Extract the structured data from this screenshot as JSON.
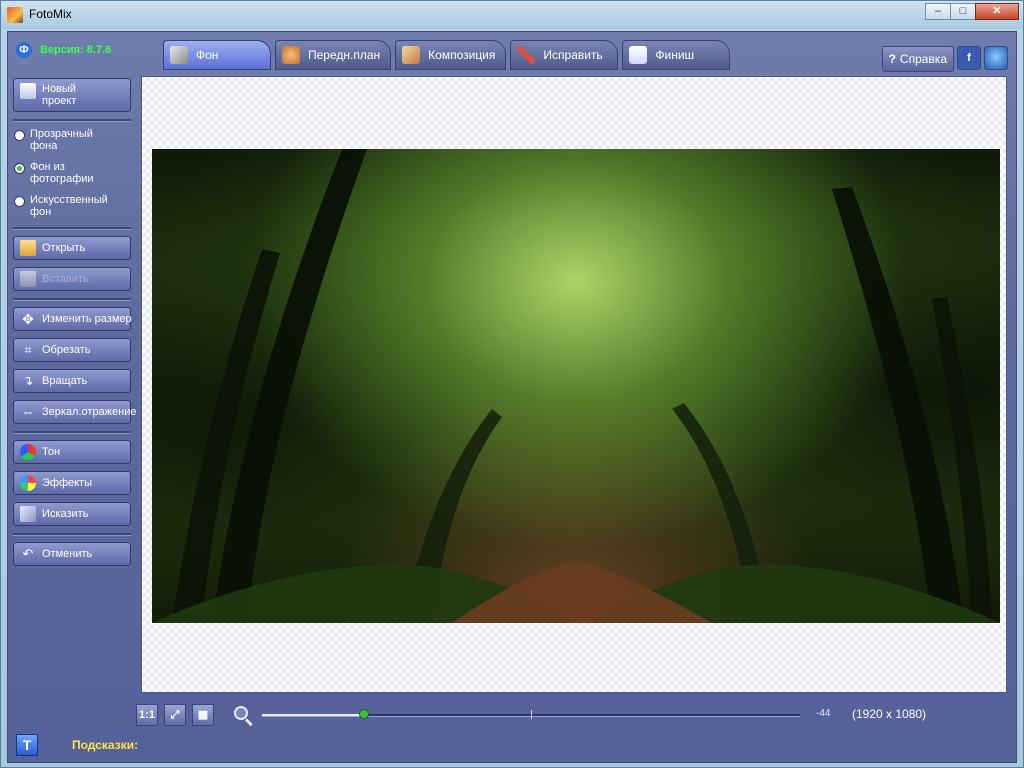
{
  "window": {
    "title": "FotoMix",
    "minimize": "‒",
    "maximize": "□",
    "close": "✕"
  },
  "header": {
    "version": "Версия: 8.7.6",
    "logo_glyph": "Ф"
  },
  "tabs": [
    {
      "label": "Фон",
      "active": true
    },
    {
      "label": "Передн.план"
    },
    {
      "label": "Композиция"
    },
    {
      "label": "Исправить"
    },
    {
      "label": "Финиш"
    }
  ],
  "top_right": {
    "help": "Справка",
    "facebook": "f"
  },
  "sidebar": {
    "new_project": "Новый проект",
    "background_options": [
      {
        "label": "Прозрачный фона",
        "selected": false
      },
      {
        "label": "Фон из фотографии",
        "selected": true
      },
      {
        "label": "Искусственный фон",
        "selected": false
      }
    ],
    "open": "Открыть",
    "paste": "Вставить",
    "resize": "Изменить размер",
    "crop": "Обрезать",
    "rotate": "Вращать",
    "mirror": "Зеркал.отражение",
    "tone": "Тон",
    "effects": "Эффекты",
    "distort": "Исказить",
    "undo": "Отменить"
  },
  "bottom_bar": {
    "actual_size": "1:1",
    "fit": "⤢",
    "grid": "▦",
    "zoom_value": "-44",
    "zoom_fraction": 0.19,
    "resolution": "(1920 x 1080)"
  },
  "status": {
    "text_tool": "T",
    "hints_label": "Подсказки:"
  },
  "colors": {
    "accent_green": "#3cff4c",
    "hints_yellow": "#ffe24a",
    "active_tab": "#5b6fd6"
  }
}
